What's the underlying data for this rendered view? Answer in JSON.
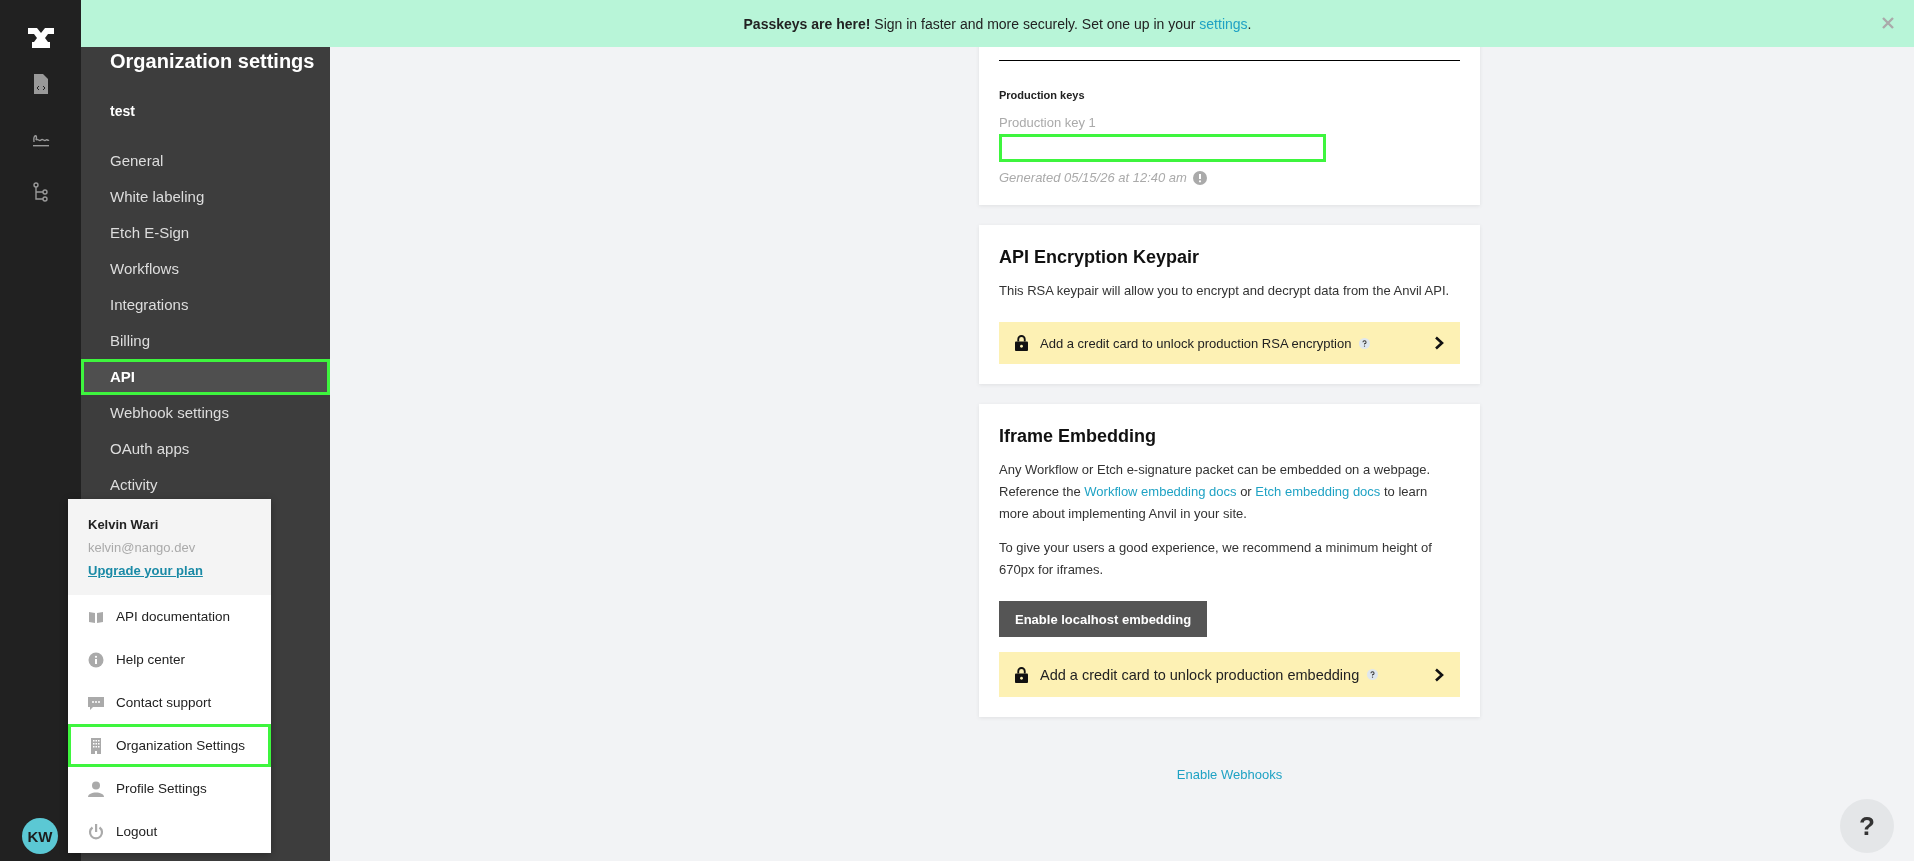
{
  "rail": {
    "avatar": "KW"
  },
  "banner": {
    "text": "**Passkeys are here!** Sign in faster and more securely. Set one up in your ",
    "link": "settings",
    "end": "."
  },
  "sidebar": {
    "title": "Organization settings",
    "org": "test",
    "items": [
      {
        "label": "General",
        "selected": false,
        "highlighted": false
      },
      {
        "label": "White labeling",
        "selected": false,
        "highlighted": false
      },
      {
        "label": "Etch E-Sign",
        "selected": false,
        "highlighted": false
      },
      {
        "label": "Workflows",
        "selected": false,
        "highlighted": false
      },
      {
        "label": "Integrations",
        "selected": false,
        "highlighted": false
      },
      {
        "label": "Billing",
        "selected": false,
        "highlighted": false
      },
      {
        "label": "API",
        "selected": true,
        "highlighted": true
      },
      {
        "label": "Webhook settings",
        "selected": false,
        "highlighted": false
      },
      {
        "label": "OAuth apps",
        "selected": false,
        "highlighted": false
      },
      {
        "label": "Activity",
        "selected": false,
        "highlighted": false
      }
    ]
  },
  "user_menu": {
    "name": "Kelvin Wari",
    "email": "kelvin@nango.dev",
    "upgrade_link": "Upgrade your plan",
    "items": [
      {
        "kind": "book",
        "label": "API documentation",
        "highlighted": false
      },
      {
        "kind": "info",
        "label": "Help center",
        "highlighted": false
      },
      {
        "kind": "chat",
        "label": "Contact support",
        "highlighted": false
      },
      {
        "kind": "building",
        "label": "Organization Settings",
        "highlighted": true
      },
      {
        "kind": "person",
        "label": "Profile Settings",
        "highlighted": false
      },
      {
        "kind": "power",
        "label": "Logout",
        "highlighted": false
      }
    ]
  },
  "production_keys": {
    "heading": "Production keys",
    "key_label": "Production key 1",
    "key_field_highlighted": true,
    "generated": "Generated 05/15/26 at 12:40 am"
  },
  "encryption_card": {
    "title": "API Encryption Keypair",
    "description": "This RSA keypair will allow you to encrypt and decrypt data from the Anvil API.",
    "unlock_banner": "Add a credit card to unlock production RSA encryption"
  },
  "iframe_card": {
    "title": "Iframe Embedding",
    "paragraph": [
      {
        "kind": "text",
        "text": "Any Workflow or Etch e-signature packet can be embedded on a webpage. Reference the "
      },
      {
        "kind": "link",
        "text": "Workflow embedding docs"
      },
      {
        "kind": "text",
        "text": " or "
      },
      {
        "kind": "link",
        "text": "Etch embedding docs"
      },
      {
        "kind": "text",
        "text": " to learn more about implementing Anvil in your site."
      }
    ],
    "note": "To give your users a good experience, we recommend a minimum height of 670px for iframes.",
    "button": "Enable localhost embedding",
    "unlock_banner": "Add a credit card to unlock production embedding"
  },
  "footer_link": "Enable Webhooks",
  "help_button": "?"
}
